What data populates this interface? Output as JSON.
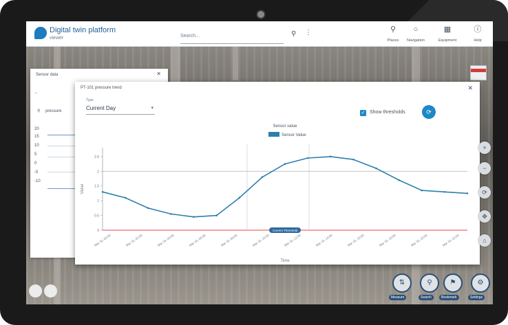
{
  "app": {
    "title": "Digital twin platform",
    "subtitle": "viewer"
  },
  "header": {
    "search_placeholder": "Search...",
    "nav": [
      {
        "icon": "pin-icon",
        "label": "Places"
      },
      {
        "icon": "layers-icon",
        "label": "Navigation"
      },
      {
        "icon": "equipment-icon",
        "label": "Equipment"
      },
      {
        "icon": "help-icon",
        "label": "Help"
      }
    ]
  },
  "left_panel": {
    "title": "Sensor data",
    "item": "pressure",
    "rows": [
      "20",
      "15",
      "10",
      "5",
      "0",
      "-5",
      "-10"
    ]
  },
  "modal": {
    "title": "PT-101 pressure trend",
    "dropdown_label": "Type",
    "dropdown_value": "Current Day",
    "checkbox_label": "Show thresholds",
    "checkbox_checked": true
  },
  "chart_data": {
    "type": "line",
    "title": "Sensor value",
    "legend": [
      "Sensor Value"
    ],
    "xlabel": "Time",
    "ylabel": "Value",
    "ylim": [
      0,
      2.8
    ],
    "x": [
      "Mar 15, 00:00",
      "Mar 15, 02:00",
      "Mar 15, 04:00",
      "Mar 15, 06:00",
      "Mar 15, 08:00",
      "Mar 15, 10:00",
      "Mar 15, 12:00",
      "Mar 15, 14:00",
      "Mar 15, 16:00",
      "Mar 15, 18:00",
      "Mar 15, 20:00",
      "Mar 15, 22:00"
    ],
    "series": [
      {
        "name": "Sensor Value",
        "values": [
          1.3,
          1.1,
          0.75,
          0.55,
          0.45,
          0.5,
          1.1,
          1.8,
          2.25,
          2.45,
          2.5,
          2.4,
          2.1,
          1.7,
          1.35,
          1.3,
          1.25
        ]
      }
    ],
    "threshold_high": 2.0,
    "threshold_low": 0.0,
    "threshold_label": "Current Threshold",
    "legend_position": "top-center",
    "grid": false,
    "colors": {
      "line": "#2b7fae",
      "threshold_low": "#e0474c",
      "threshold_high": "#b0b0b0"
    }
  },
  "bottom_tools": [
    {
      "icon": "measure-icon",
      "label": "Measure"
    },
    {
      "icon": "search-icon",
      "label": "Search"
    },
    {
      "icon": "bookmark-icon",
      "label": "Bookmark"
    },
    {
      "icon": "settings-icon",
      "label": "Settings"
    }
  ],
  "side_tools": [
    "zoom-in-icon",
    "zoom-out-icon",
    "rotate-icon",
    "pan-icon",
    "home-icon"
  ]
}
